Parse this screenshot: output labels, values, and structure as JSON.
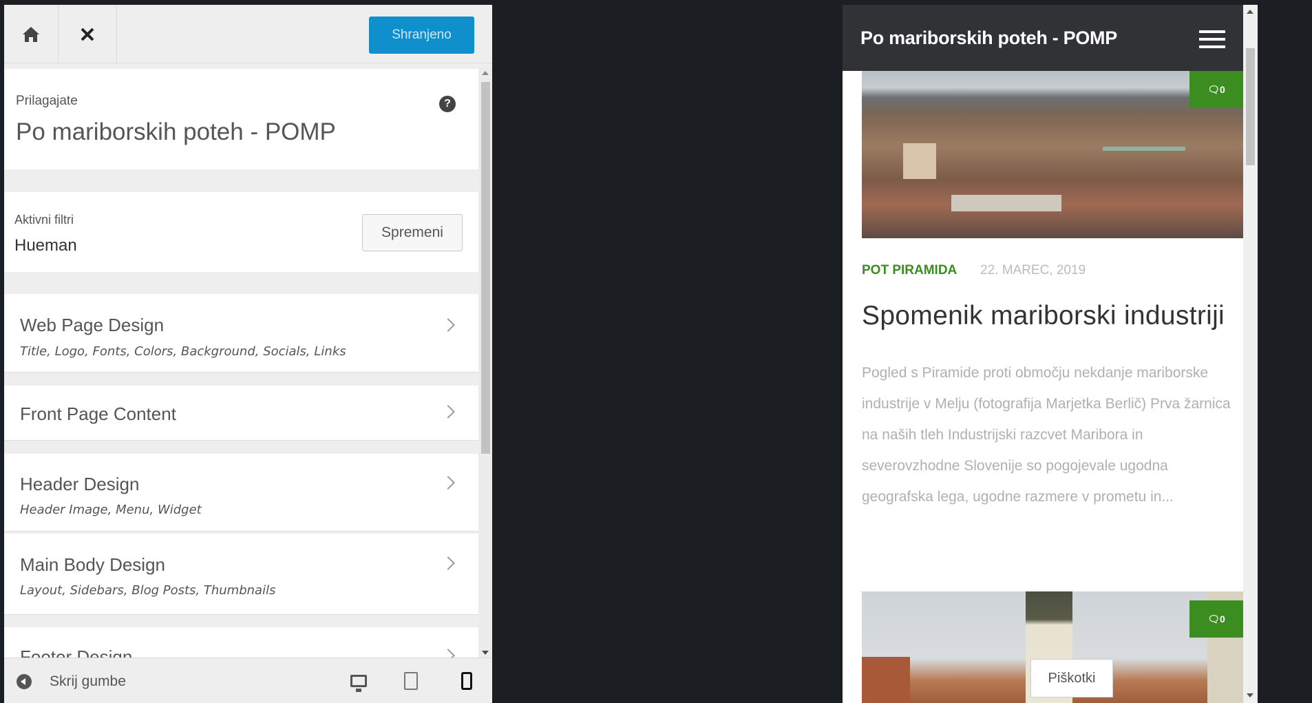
{
  "topbar": {
    "home_icon": "home-icon",
    "close_icon": "close-icon",
    "save_label": "Shranjeno"
  },
  "info": {
    "label": "Prilagajate",
    "title": "Po mariborskih poteh - POMP",
    "help_icon": "question-icon",
    "help_glyph": "?"
  },
  "filters": {
    "label": "Aktivni filtri",
    "value": "Hueman",
    "change_label": "Spremeni"
  },
  "sections": [
    {
      "title": "Web Page Design",
      "subtitle": "Title, Logo, Fonts, Colors, Background, Socials, Links"
    },
    {
      "title": "Front Page Content",
      "subtitle": ""
    },
    {
      "title": "Header Design",
      "subtitle": "Header Image, Menu, Widget"
    },
    {
      "title": "Main Body Design",
      "subtitle": "Layout, Sidebars, Blog Posts, Thumbnails"
    },
    {
      "title": "Footer Design",
      "subtitle": ""
    }
  ],
  "bottombar": {
    "collapse_label": "Skrij gumbe",
    "devices": [
      "desktop-icon",
      "tablet-icon",
      "mobile-icon"
    ],
    "active_device": "mobile-icon"
  },
  "preview": {
    "site_title": "Po mariborskih poteh - POMP",
    "menu_icon": "hamburger-menu-icon",
    "post": {
      "category": "POT PIRAMIDA",
      "date": "22. MAREC, 2019",
      "title": "Spomenik mariborski industriji",
      "excerpt": "Pogled s Piramide proti območju nekdanje mariborske industrije v Melju (fotografija Marjetka Berlič) Prva žarnica na naših tleh Industrijski razcvet Maribora in severovzhodne Slovenije so pogojevale ugodna geografska lega, ugodne razmere v prometu in..."
    },
    "comment_count": "0",
    "cookie_label": "Piškotki"
  },
  "colors": {
    "save_button": "#0f8fcc",
    "accent_green": "#3b8d1f",
    "site_header": "#313236",
    "backdrop": "#1b1f24"
  }
}
